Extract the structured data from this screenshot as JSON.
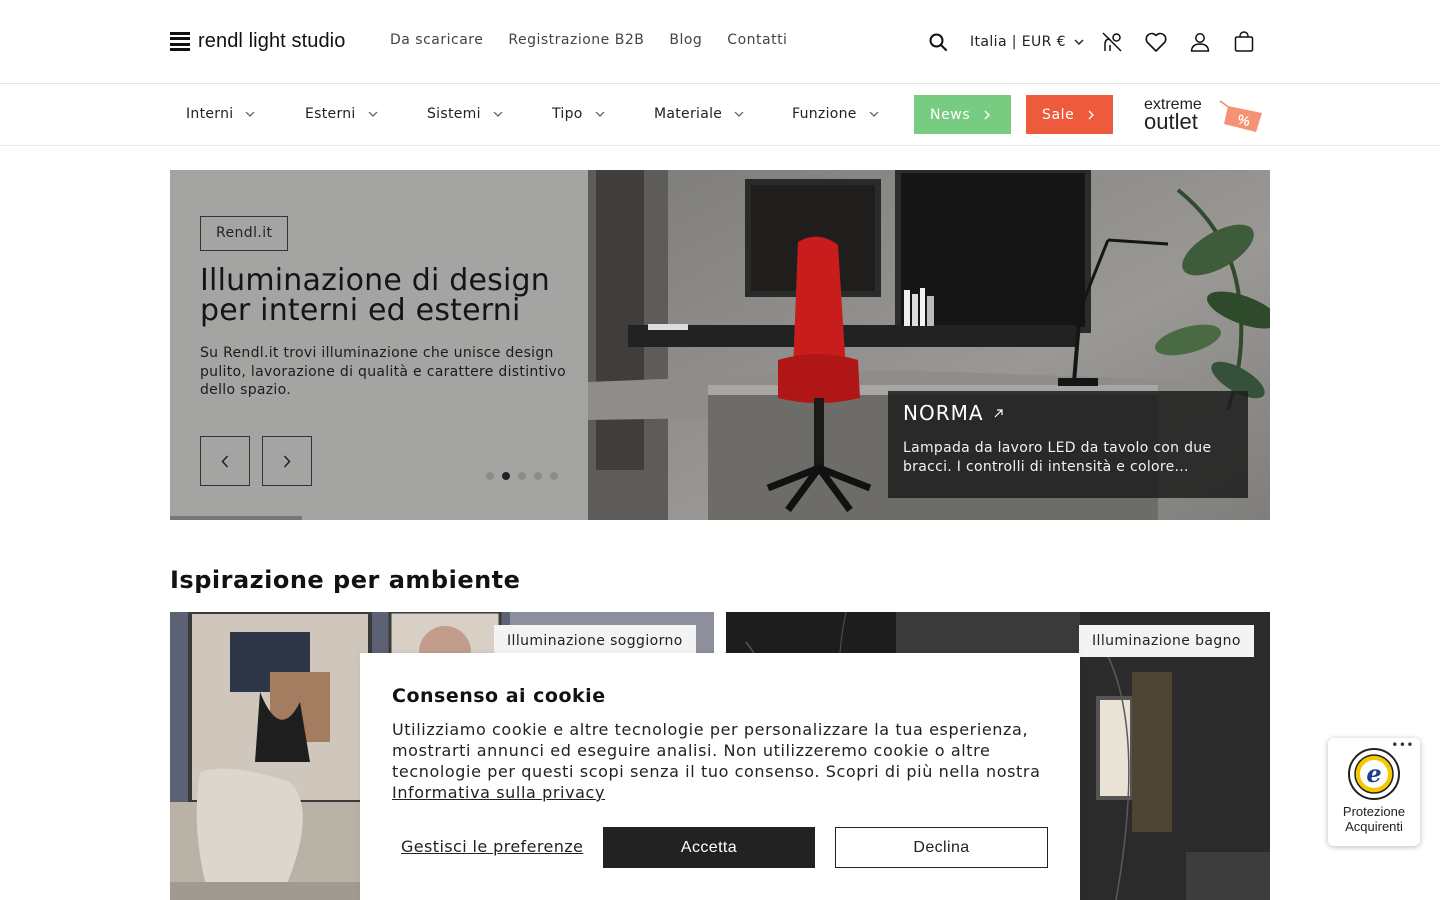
{
  "header": {
    "logo_text": "rendl light studio",
    "nav": [
      "Da scaricare",
      "Registrazione B2B",
      "Blog",
      "Contatti"
    ],
    "locale": "Italia | EUR €"
  },
  "mainnav": {
    "items": [
      "Interni",
      "Esterni",
      "Sistemi",
      "Tipo",
      "Materiale",
      "Funzione"
    ],
    "news_label": "News",
    "sale_label": "Sale",
    "outlet_line1": "extreme",
    "outlet_line2": "outlet",
    "outlet_badge": "%",
    "colors": {
      "news": "#77cc82",
      "sale": "#ee5a3c"
    }
  },
  "hero": {
    "tag": "Rendl.it",
    "title": "Illuminazione di design per interni ed esterni",
    "description": "Su Rendl.it trovi illuminazione che unisce design pulito, lavorazione di qualità e carattere distintivo dello spazio.",
    "active_slide": 2,
    "slide_count": 5,
    "product_name": "NORMA",
    "product_desc": "Lampada da lavoro LED da tavolo con due bracci. I controlli di intensità e colore..."
  },
  "section": {
    "title": "Ispirazione per ambiente",
    "rooms": [
      "Illuminazione soggiorno",
      "Illuminazione bagno"
    ]
  },
  "cookie": {
    "title": "Consenso ai cookie",
    "text": "Utilizziamo cookie e altre tecnologie per personalizzare la tua esperienza, mostrarti annunci ed eseguire analisi. Non utilizzeremo cookie o altre tecnologie per questi scopi senza il tuo consenso. Scopri di più nella nostra ",
    "privacy_link": "Informativa sulla privacy",
    "manage": "Gestisci le preferenze",
    "accept": "Accetta",
    "decline": "Declina"
  },
  "trusted": {
    "more": "•••",
    "label_line1": "Protezione",
    "label_line2": "Acquirenti",
    "seal_letter": "e"
  }
}
